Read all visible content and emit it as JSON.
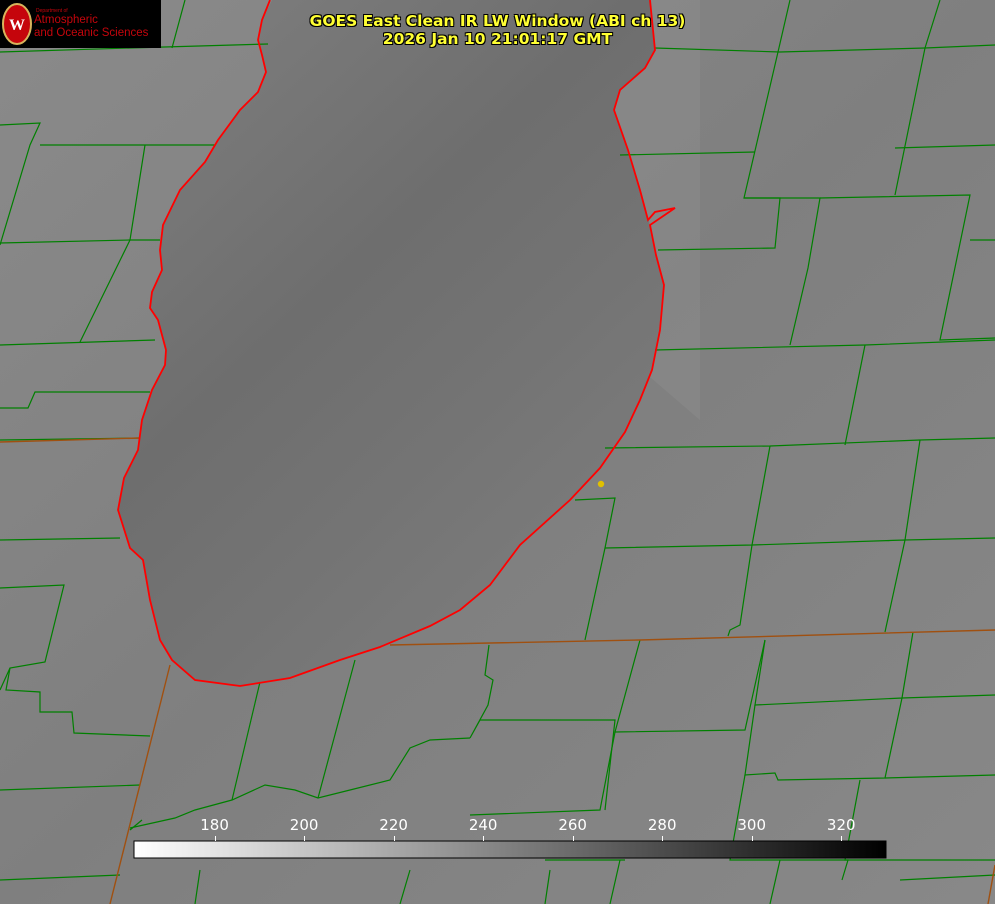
{
  "title": {
    "line1": "GOES East Clean IR LW Window (ABI ch 13)",
    "line2": "2026 Jan 10 21:01:17 GMT",
    "color": "#ffff33"
  },
  "logo": {
    "dept": "Department of",
    "line1": "Atmospheric",
    "line2": "and Oceanic Sciences",
    "color": "#c5050c"
  },
  "colorbar": {
    "min": 162,
    "max": 330,
    "gradient": "white-to-black",
    "tick_values": [
      180,
      200,
      220,
      240,
      260,
      280,
      300,
      320
    ],
    "ticks": [
      "180",
      "200",
      "220",
      "240",
      "260",
      "280",
      "300",
      "320"
    ]
  },
  "map": {
    "boundary_color": "#008000",
    "lakeshore_color": "#ff0000",
    "state_line_color": "#a05010",
    "marker_color": "#e0c000"
  }
}
